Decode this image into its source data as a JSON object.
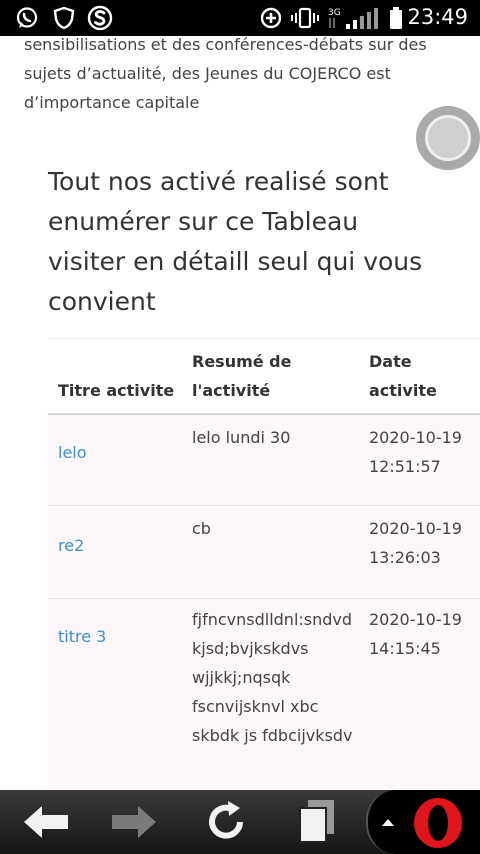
{
  "status_bar": {
    "time": "23:49",
    "network_label": "3G",
    "icons": [
      "whatsapp-icon",
      "shield-icon",
      "s-app-icon",
      "data-saver-icon",
      "vibrate-icon",
      "signal-icon",
      "battery-icon"
    ]
  },
  "page": {
    "intro_text": "sensibilisations et des conférences-débats sur des sujets d’actualité, des Jeunes du COJERCO est d’importance capitale",
    "heading": "Tout nos activé realisé sont enumérer sur ce Tableau visiter en détaill seul qui vous convient"
  },
  "table": {
    "headers": [
      "Titre activite",
      "Resumé de l'activité",
      "Date activite"
    ],
    "rows": [
      {
        "title": "lelo",
        "summary": "lelo lundi 30",
        "date": "2020-10-19 12:51:57"
      },
      {
        "title": "re2",
        "summary": "cb",
        "date": "2020-10-19 13:26:03"
      },
      {
        "title": "titre 3",
        "summary": "fjfncvnsdlldnl:sndvd kjsd;bvjkskdvs wjjkkj;nqsqk fscnvijsknvl xbc skbdk js fdbcijvksdv",
        "date": "2020-10-19 14:15:45"
      }
    ]
  },
  "colors": {
    "link": "#3f8fcb",
    "row_bg": "#fbf7fb",
    "opera_red": "#e0141a"
  },
  "nav_bar": {
    "icons": [
      "back-arrow-icon",
      "forward-arrow-icon",
      "reload-icon",
      "tabs-icon",
      "menu-up-icon",
      "opera-logo-icon"
    ]
  }
}
